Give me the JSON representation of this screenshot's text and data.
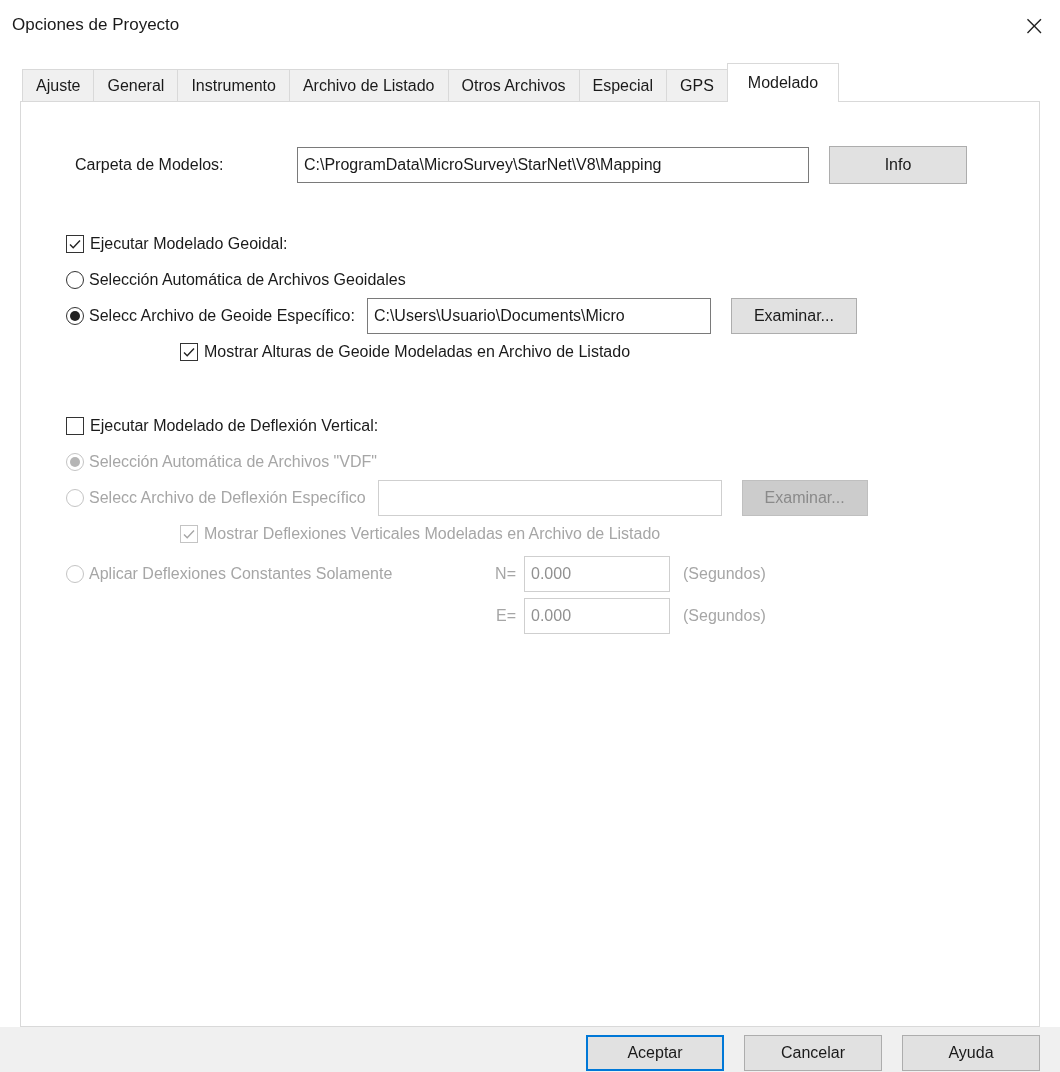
{
  "window": {
    "title": "Opciones de Proyecto",
    "close": "×"
  },
  "tabs": [
    {
      "label": "Ajuste",
      "selected": false
    },
    {
      "label": "General",
      "selected": false
    },
    {
      "label": "Instrumento",
      "selected": false
    },
    {
      "label": "Archivo de Listado",
      "selected": false
    },
    {
      "label": "Otros Archivos",
      "selected": false
    },
    {
      "label": "Especial",
      "selected": false
    },
    {
      "label": "GPS",
      "selected": false
    },
    {
      "label": "Modelado",
      "selected": true
    }
  ],
  "models_folder": {
    "label": "Carpeta de Modelos:",
    "value": "C:\\ProgramData\\MicroSurvey\\StarNet\\V8\\Mapping",
    "button": "Info"
  },
  "sections": [
    {
      "label": "Ejecutar Modelado Geoidal:",
      "checked": true,
      "disabled": false,
      "items": [
        {
          "kind": "radio",
          "label": "Selección Automática de Archivos Geoidales",
          "selected": false
        },
        {
          "kind": "file",
          "label": "Selecc Archivo de Geoide Específico:",
          "selected": true,
          "value": "C:\\Users\\Usuario\\Documents\\Micro",
          "button": "Examinar..."
        },
        {
          "kind": "check",
          "label": "Mostrar Alturas de Geoide Modeladas en Archivo de Listado",
          "checked": true
        }
      ]
    },
    {
      "label": "Ejecutar Modelado de Deflexión Vertical:",
      "checked": false,
      "disabled": true,
      "items": [
        {
          "kind": "radio",
          "label": "Selección Automática de Archivos \"VDF\"",
          "selected": true
        },
        {
          "kind": "file",
          "label": "Selecc Archivo de Deflexión Específico",
          "selected": false,
          "button": "Examinar..."
        },
        {
          "kind": "check",
          "label": "Mostrar Deflexiones Verticales Modeladas en Archivo de Listado",
          "checked": true
        },
        {
          "kind": "constants",
          "label": "Aplicar Deflexiones Constantes Solamente",
          "selected": false,
          "n_label": "N=",
          "n_value": "0.000",
          "n_unit": "(Segundos)",
          "e_label": "E=",
          "e_value": "0.000",
          "e_unit": "(Segundos)"
        }
      ]
    }
  ],
  "buttons": [
    {
      "label": "Aceptar",
      "default": true
    },
    {
      "label": "Cancelar",
      "default": false
    },
    {
      "label": "Ayuda",
      "default": false
    }
  ]
}
